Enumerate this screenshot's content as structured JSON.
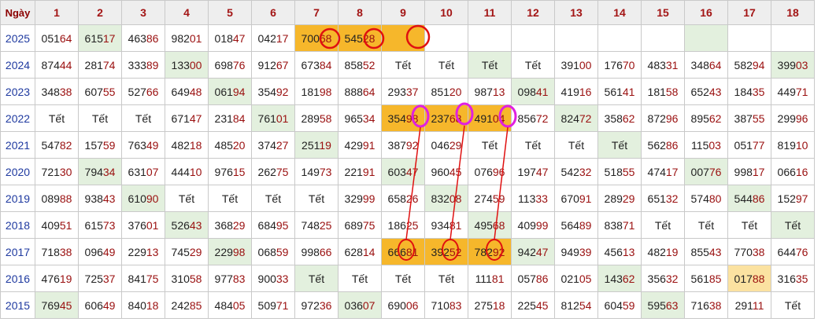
{
  "header": {
    "corner": "Ngày",
    "days": [
      "1",
      "2",
      "3",
      "4",
      "5",
      "6",
      "7",
      "8",
      "9",
      "10",
      "11",
      "12",
      "13",
      "14",
      "15",
      "16",
      "17",
      "18"
    ]
  },
  "rows": [
    {
      "year": "2025",
      "cells": [
        "05164",
        "61517",
        "46386",
        "98201",
        "01847",
        "04217",
        "70068",
        "54528",
        "",
        "",
        "",
        "",
        "",
        "",
        "",
        "",
        "",
        ""
      ],
      "styles": [
        "",
        "g",
        "",
        "",
        "",
        "",
        "o",
        "o",
        "o",
        "",
        "",
        "",
        "",
        "",
        "",
        "g",
        "",
        ""
      ]
    },
    {
      "year": "2024",
      "cells": [
        "87444",
        "28174",
        "33389",
        "13300",
        "69876",
        "91267",
        "67384",
        "85852",
        "Tết",
        "Tết",
        "Tết",
        "Tết",
        "39100",
        "17670",
        "48331",
        "34864",
        "58294",
        "39903"
      ],
      "styles": [
        "",
        "",
        "",
        "g",
        "",
        "",
        "",
        "",
        "",
        "",
        "g",
        "",
        "",
        "",
        "",
        "",
        "",
        "g"
      ]
    },
    {
      "year": "2023",
      "cells": [
        "34838",
        "60755",
        "52766",
        "64948",
        "06194",
        "35492",
        "18198",
        "88864",
        "29337",
        "85120",
        "98713",
        "09841",
        "41916",
        "56141",
        "18158",
        "65243",
        "18435",
        "44971"
      ],
      "styles": [
        "",
        "",
        "",
        "",
        "g",
        "",
        "",
        "",
        "",
        "",
        "",
        "g",
        "",
        "",
        "",
        "",
        "",
        ""
      ]
    },
    {
      "year": "2022",
      "cells": [
        "Tết",
        "Tết",
        "Tết",
        "67147",
        "23184",
        "76101",
        "28958",
        "96534",
        "35498",
        "23768",
        "49104",
        "85672",
        "82472",
        "35862",
        "87296",
        "89562",
        "38755",
        "29996"
      ],
      "styles": [
        "",
        "",
        "",
        "",
        "",
        "g",
        "",
        "",
        "o",
        "o",
        "o",
        "",
        "g",
        "",
        "",
        "",
        "",
        ""
      ]
    },
    {
      "year": "2021",
      "cells": [
        "54782",
        "15759",
        "76349",
        "48218",
        "48520",
        "37427",
        "25119",
        "42991",
        "38792",
        "04629",
        "Tết",
        "Tết",
        "Tết",
        "Tết",
        "56286",
        "11503",
        "05177",
        "81910"
      ],
      "styles": [
        "",
        "",
        "",
        "",
        "",
        "",
        "g",
        "",
        "",
        "",
        "",
        "",
        "",
        "g",
        "",
        "",
        "",
        ""
      ]
    },
    {
      "year": "2020",
      "cells": [
        "72130",
        "79434",
        "63107",
        "44410",
        "97615",
        "26275",
        "14973",
        "22191",
        "60347",
        "96045",
        "07696",
        "19747",
        "54232",
        "51855",
        "47417",
        "00776",
        "99817",
        "06616"
      ],
      "styles": [
        "",
        "g",
        "",
        "",
        "",
        "",
        "",
        "",
        "g",
        "",
        "",
        "",
        "",
        "",
        "",
        "g",
        "",
        ""
      ]
    },
    {
      "year": "2019",
      "cells": [
        "08988",
        "93843",
        "61090",
        "Tết",
        "Tết",
        "Tết",
        "Tết",
        "32999",
        "65826",
        "83208",
        "27459",
        "11333",
        "67091",
        "28929",
        "65132",
        "57480",
        "54486",
        "15297"
      ],
      "styles": [
        "",
        "",
        "g",
        "",
        "",
        "",
        "",
        "",
        "",
        "g",
        "",
        "",
        "",
        "",
        "",
        "",
        "g",
        ""
      ]
    },
    {
      "year": "2018",
      "cells": [
        "40951",
        "61573",
        "37601",
        "52643",
        "36829",
        "68495",
        "74825",
        "68975",
        "18625",
        "93481",
        "49568",
        "40999",
        "56489",
        "83871",
        "Tết",
        "Tết",
        "Tết",
        "Tết"
      ],
      "styles": [
        "",
        "",
        "",
        "g",
        "",
        "",
        "",
        "",
        "",
        "",
        "g",
        "",
        "",
        "",
        "",
        "",
        "",
        "g"
      ]
    },
    {
      "year": "2017",
      "cells": [
        "71838",
        "09649",
        "22913",
        "74529",
        "22998",
        "06859",
        "99866",
        "62814",
        "66681",
        "39252",
        "78292",
        "94247",
        "94939",
        "45613",
        "48219",
        "85543",
        "77038",
        "64476"
      ],
      "styles": [
        "",
        "",
        "",
        "",
        "g",
        "",
        "",
        "",
        "o",
        "o",
        "o",
        "g",
        "",
        "",
        "",
        "",
        "",
        ""
      ]
    },
    {
      "year": "2016",
      "cells": [
        "47619",
        "72537",
        "84175",
        "31058",
        "97783",
        "90033",
        "Tết",
        "Tết",
        "Tết",
        "Tết",
        "11181",
        "05786",
        "02105",
        "14362",
        "35632",
        "56185",
        "01788",
        "31635"
      ],
      "styles": [
        "",
        "",
        "",
        "",
        "",
        "",
        "g",
        "",
        "",
        "",
        "",
        "",
        "",
        "g",
        "",
        "",
        "c",
        ""
      ]
    },
    {
      "year": "2015",
      "cells": [
        "76945",
        "60649",
        "84018",
        "24285",
        "48405",
        "50971",
        "97236",
        "03607",
        "69006",
        "71083",
        "27518",
        "22545",
        "81254",
        "60459",
        "59563",
        "71638",
        "29111",
        "Tết"
      ],
      "styles": [
        "g",
        "",
        "",
        "",
        "",
        "",
        "",
        "g",
        "",
        "",
        "",
        "",
        "",
        "",
        "g",
        "",
        "",
        ""
      ]
    }
  ],
  "colors": {
    "header_text": "#a31515",
    "year_text": "#1f3aa0",
    "green_cell": "#e3f0de",
    "orange_cell": "#f6b72b",
    "cream_cell": "#fbe2a1",
    "red_mark": "#e01010",
    "magenta_mark": "#e020e0"
  }
}
